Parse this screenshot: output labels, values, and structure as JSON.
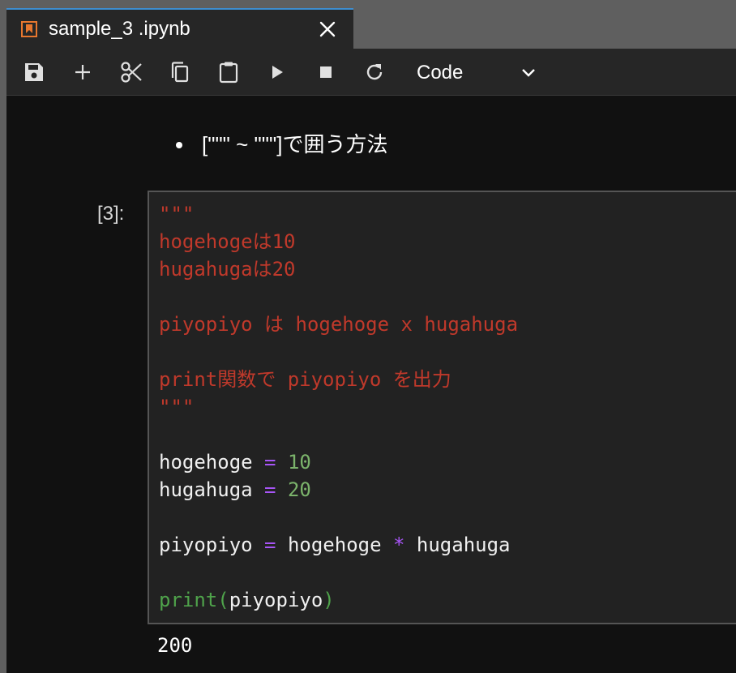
{
  "tab": {
    "title": "sample_3 .ipynb",
    "icon": "notebook-icon",
    "close_icon": "close-icon"
  },
  "toolbar": {
    "buttons": [
      "save-icon",
      "plus-icon",
      "scissors-icon",
      "copy-icon",
      "paste-icon",
      "run-icon",
      "stop-icon",
      "restart-icon"
    ],
    "cell_type": "Code"
  },
  "markdown": {
    "bullet_text": "[\"\"\" ~ \"\"\"]で囲う方法"
  },
  "cell": {
    "prompt": "[3]:",
    "lines": {
      "l1": "\"\"\"",
      "l2": "hogehogeは10",
      "l3": "hugahugaは20",
      "l4": "piyopiyo は hogehoge x hugahuga",
      "l5": "print関数で piyopiyo を出力",
      "l6": "\"\"\"",
      "l7_var": "hogehoge",
      "l7_op": "=",
      "l7_num": "10",
      "l8_var": "hugahuga",
      "l8_op": "=",
      "l8_num": "20",
      "l9_var": "piyopiyo",
      "l9_op1": "=",
      "l9_var2": "hogehoge",
      "l9_op2": "*",
      "l9_var3": "hugahuga",
      "l10_fn": "print(",
      "l10_arg": "piyopiyo",
      "l10_close": ")"
    },
    "output": "200"
  },
  "colors": {
    "accent": "#3e8ed0",
    "string": "#c0392b",
    "operator": "#a855f7",
    "number": "#7bb36b",
    "builtin": "#4fa34b",
    "icon_orange": "#e8772e"
  }
}
